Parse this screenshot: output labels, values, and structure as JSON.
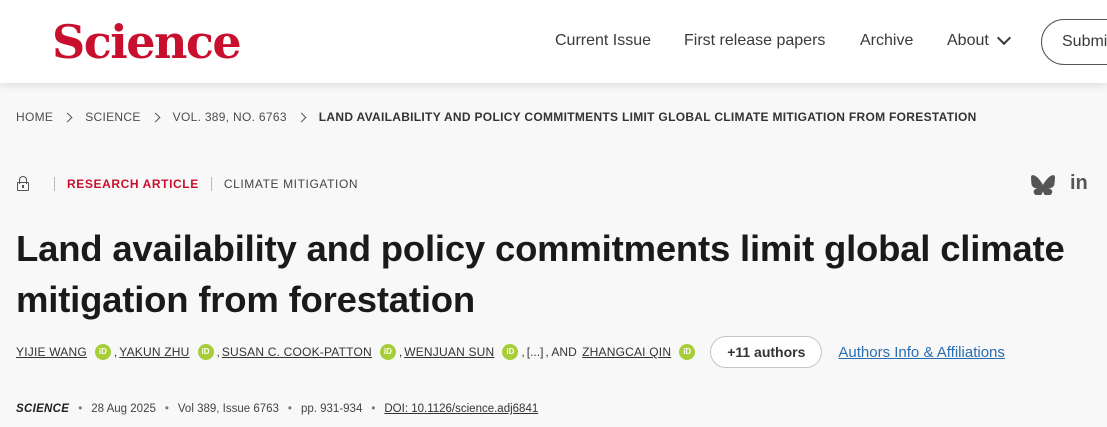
{
  "header": {
    "logo": "Science",
    "nav": {
      "current_issue": "Current Issue",
      "first_release": "First release papers",
      "archive": "Archive",
      "about": "About"
    },
    "submit_label": "Submi"
  },
  "breadcrumb": {
    "items": [
      "HOME",
      "SCIENCE",
      "VOL. 389, NO. 6763"
    ],
    "current": "LAND AVAILABILITY AND POLICY COMMITMENTS LIMIT GLOBAL CLIMATE MITIGATION FROM FORESTATION"
  },
  "article": {
    "type": "RESEARCH ARTICLE",
    "topic": "CLIMATE MITIGATION",
    "title": "Land availability and policy commitments limit global climate mitigation from forestation",
    "authors": [
      "YIJIE WANG",
      "YAKUN ZHU",
      "SUSAN C. COOK-PATTON",
      "WENJUAN SUN",
      "ZHANGCAI QIN"
    ],
    "ellipsis": "[...]",
    "and_text": ", AND",
    "comma": ",",
    "more_authors": "+11 authors",
    "affiliations_link": "Authors Info & Affiliations",
    "orcid_label": "iD"
  },
  "publication": {
    "journal": "SCIENCE",
    "date": "28 Aug 2025",
    "volume_issue": "Vol 389, Issue 6763",
    "pages": "pp. 931-934",
    "doi": "DOI: 10.1126/science.adj6841",
    "separator": "•"
  },
  "icons": {
    "lock": "lock-icon",
    "bluesky": "bluesky-icon",
    "linkedin": "linkedin-icon",
    "orcid": "orcid-icon",
    "about_chevron": "chevron-down-icon",
    "breadcrumb_separator": "chevron-right-icon"
  },
  "colors": {
    "brand": "#c8102e",
    "orcid": "#a6ce39",
    "link": "#2a6db0",
    "background": "#f8f8f8"
  }
}
